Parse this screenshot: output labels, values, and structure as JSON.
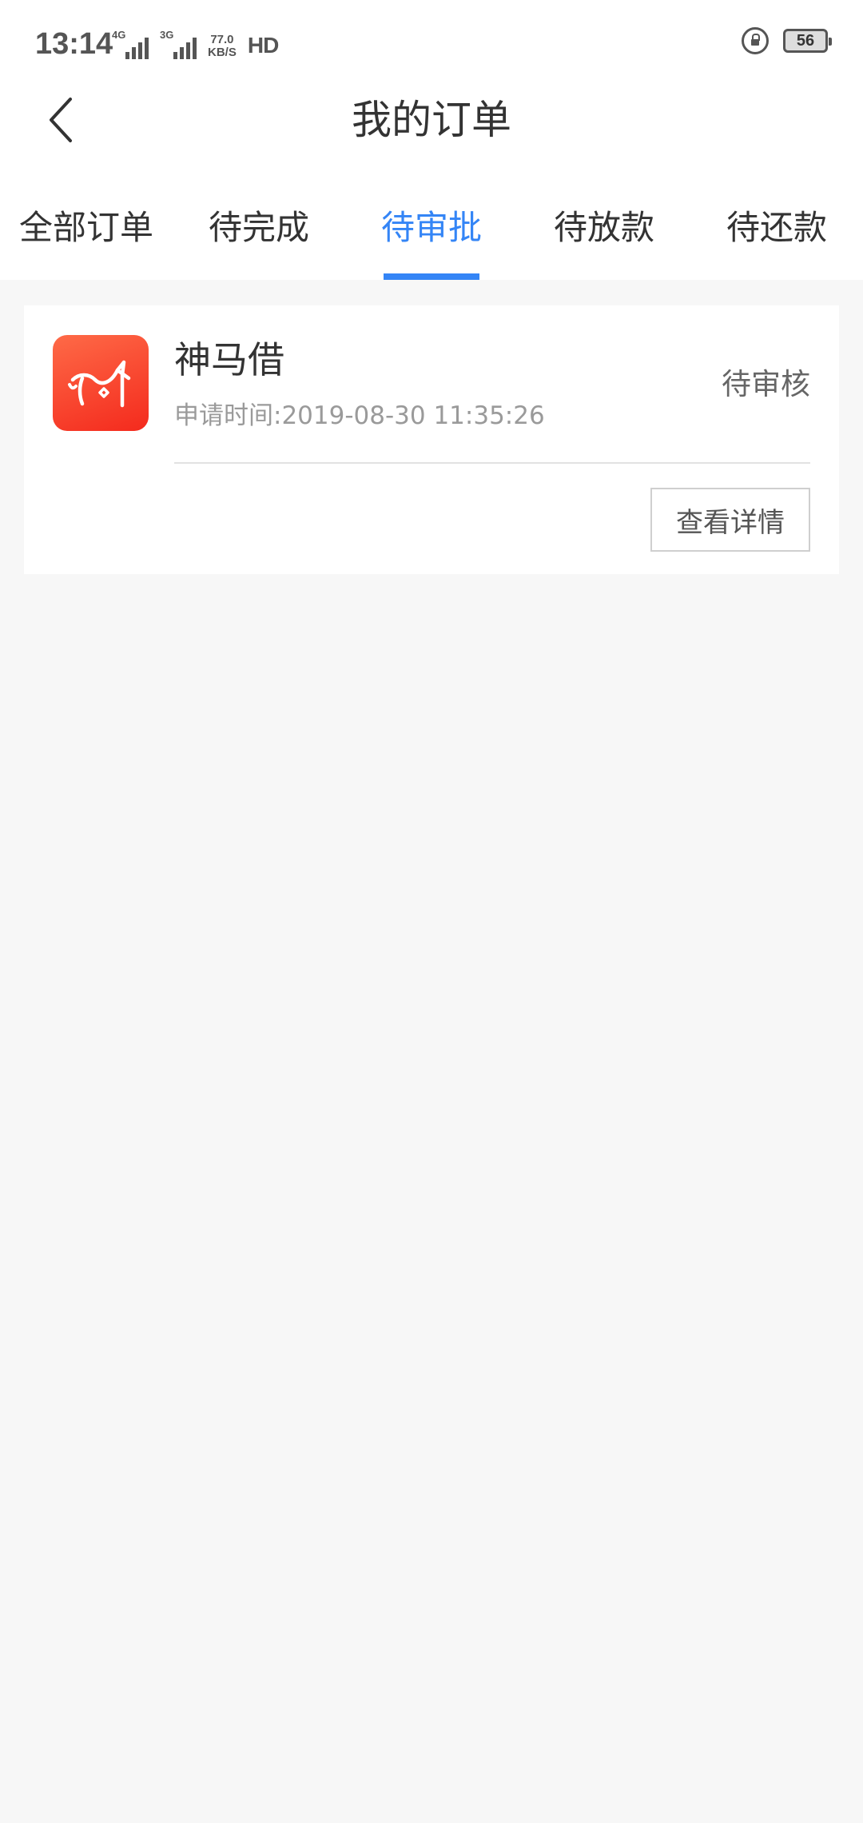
{
  "status_bar": {
    "time": "13:14",
    "signal_1_label": "4G",
    "signal_2_label": "3G",
    "net_speed_value": "77.0",
    "net_speed_unit": "KB/S",
    "hd_label": "HD",
    "battery_level": "56"
  },
  "header": {
    "title": "我的订单",
    "back_icon": "chevron-left-icon"
  },
  "tabs": [
    {
      "label": "全部订单",
      "active": false
    },
    {
      "label": "待完成",
      "active": false
    },
    {
      "label": "待审批",
      "active": true
    },
    {
      "label": "待放款",
      "active": false
    },
    {
      "label": "待还款",
      "active": false
    }
  ],
  "orders": [
    {
      "logo_icon": "horse-logo-icon",
      "product_name": "神马借",
      "apply_time": "申请时间:2019-08-30 11:35:26",
      "status": "待审核",
      "detail_button": "查看详情"
    }
  ],
  "colors": {
    "accent": "#3485f6",
    "logo_top": "#fe6a47",
    "logo_bottom": "#f42a1d",
    "page_bg": "#f7f7f7"
  }
}
